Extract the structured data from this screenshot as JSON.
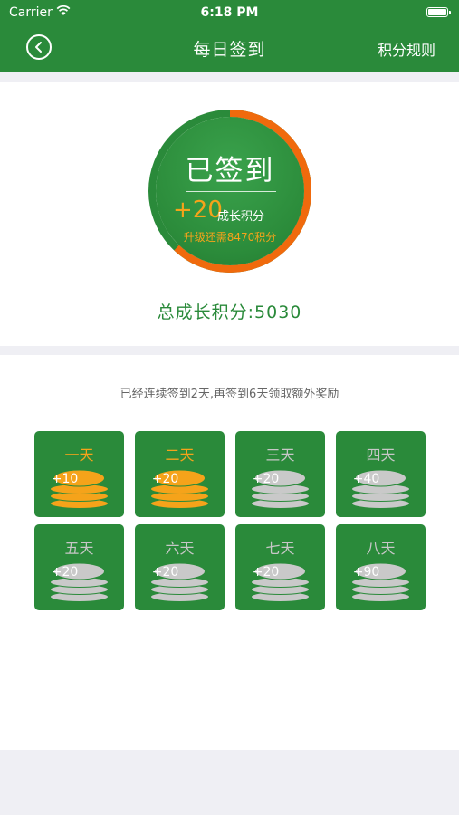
{
  "status_bar": {
    "carrier": "Carrier",
    "time": "6:18 PM"
  },
  "nav": {
    "title": "每日签到",
    "rules_label": "积分规则"
  },
  "badge": {
    "status": "已签到",
    "earned_points": "+20",
    "earned_label": "成长积分",
    "upgrade_text": "升级还需8470积分",
    "ring_progress": 0.62
  },
  "total_points": "总成长积分:5030",
  "streak_text": "已经连续签到2天,再签到6天领取额外奖励",
  "days": [
    {
      "label": "一天",
      "points": "+10",
      "claimed": true
    },
    {
      "label": "二天",
      "points": "+20",
      "claimed": true
    },
    {
      "label": "三天",
      "points": "+20",
      "claimed": false
    },
    {
      "label": "四天",
      "points": "+40",
      "claimed": false
    },
    {
      "label": "五天",
      "points": "+20",
      "claimed": false
    },
    {
      "label": "六天",
      "points": "+20",
      "claimed": false
    },
    {
      "label": "七天",
      "points": "+20",
      "claimed": false
    },
    {
      "label": "八天",
      "points": "+90",
      "claimed": false
    }
  ],
  "colors": {
    "brand_green": "#2a8a3a",
    "accent_orange": "#f5a31a",
    "ring_orange": "#f06a0d",
    "coin_gold": "#f5a31a",
    "coin_gray": "#c9c9c9"
  }
}
